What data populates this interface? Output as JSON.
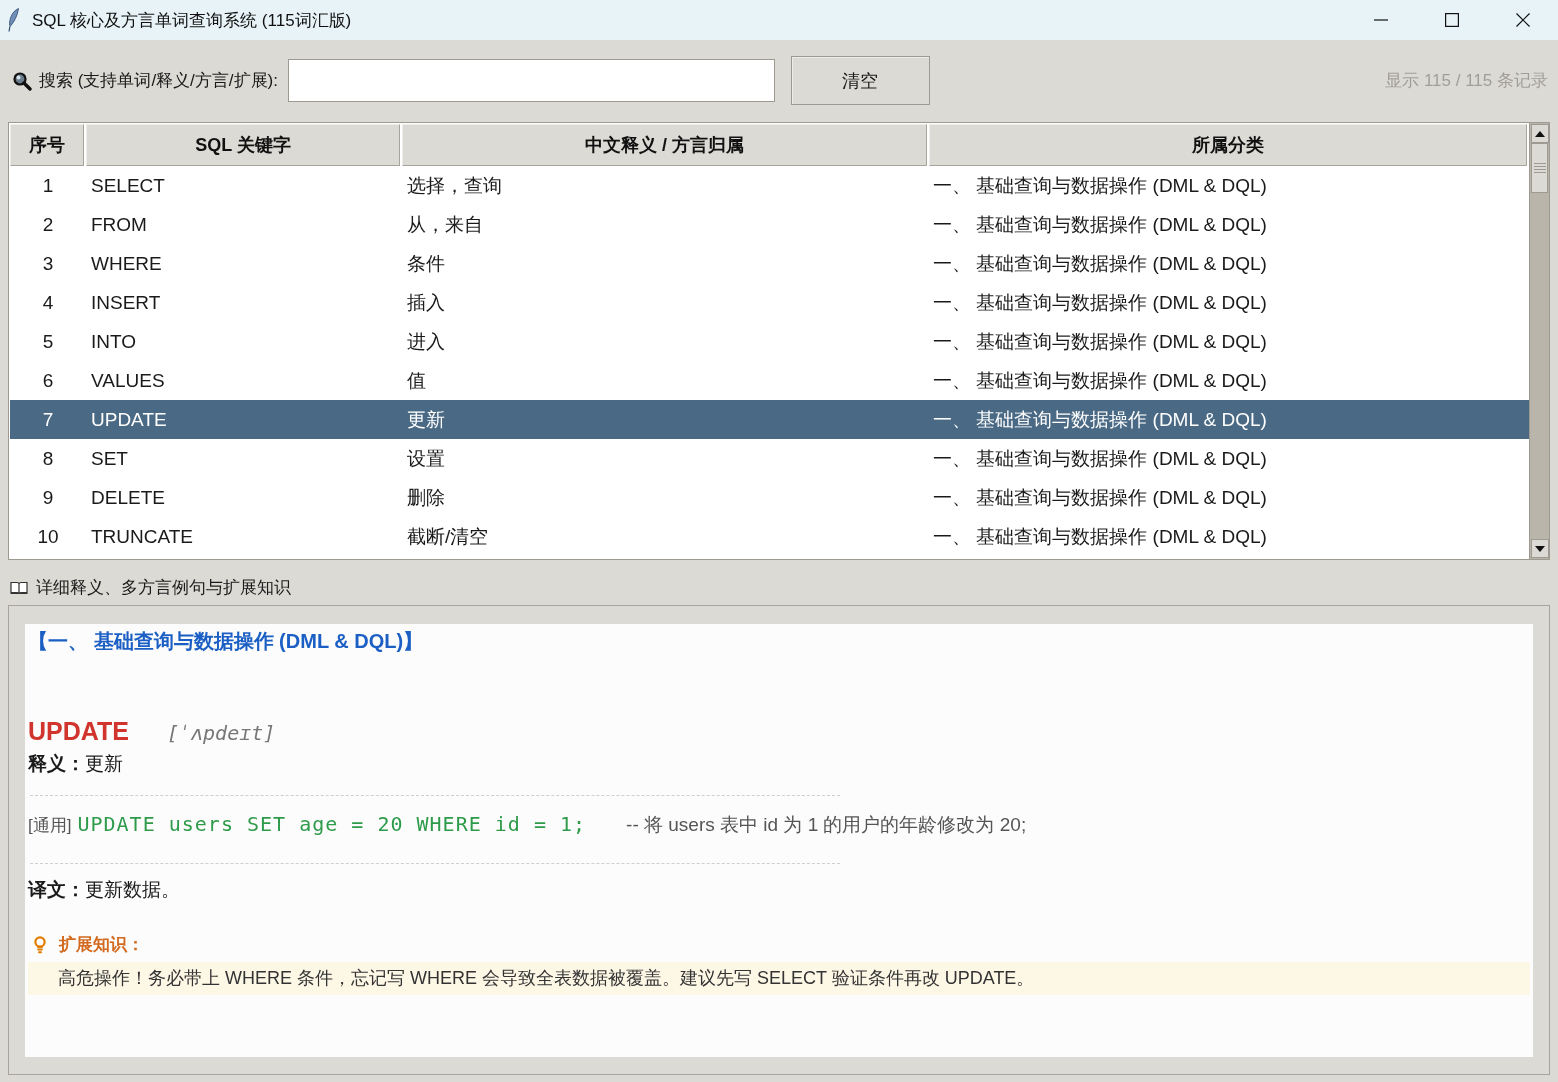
{
  "window": {
    "title": "SQL 核心及方言单词查询系统 (115词汇版)"
  },
  "search": {
    "label": "搜索 (支持单词/释义/方言/扩展):"
  },
  "clear_button": "清空",
  "record_count": "显示 115 / 115 条记录",
  "table": {
    "columns": [
      "序号",
      "SQL 关键字",
      "中文释义 / 方言归属",
      "所属分类"
    ],
    "rows": [
      {
        "cells": [
          "1",
          "SELECT",
          "选择，查询",
          "一、 基础查询与数据操作 (DML & DQL)"
        ],
        "selected": false
      },
      {
        "cells": [
          "2",
          "FROM",
          "从，来自",
          "一、 基础查询与数据操作 (DML & DQL)"
        ],
        "selected": false
      },
      {
        "cells": [
          "3",
          "WHERE",
          "条件",
          "一、 基础查询与数据操作 (DML & DQL)"
        ],
        "selected": false
      },
      {
        "cells": [
          "4",
          "INSERT",
          "插入",
          "一、 基础查询与数据操作 (DML & DQL)"
        ],
        "selected": false
      },
      {
        "cells": [
          "5",
          "INTO",
          "进入",
          "一、 基础查询与数据操作 (DML & DQL)"
        ],
        "selected": false
      },
      {
        "cells": [
          "6",
          "VALUES",
          "值",
          "一、 基础查询与数据操作 (DML & DQL)"
        ],
        "selected": false
      },
      {
        "cells": [
          "7",
          "UPDATE",
          "更新",
          "一、 基础查询与数据操作 (DML & DQL)"
        ],
        "selected": true
      },
      {
        "cells": [
          "8",
          "SET",
          "设置",
          "一、 基础查询与数据操作 (DML & DQL)"
        ],
        "selected": false
      },
      {
        "cells": [
          "9",
          "DELETE",
          "删除",
          "一、 基础查询与数据操作 (DML & DQL)"
        ],
        "selected": false
      },
      {
        "cells": [
          "10",
          "TRUNCATE",
          "截断/清空",
          "一、 基础查询与数据操作 (DML & DQL)"
        ],
        "selected": false
      }
    ]
  },
  "detail": {
    "title": "详细释义、多方言例句与扩展知识",
    "category_heading": "【一、 基础查询与数据操作 (DML & DQL)】",
    "keyword": "UPDATE",
    "phonetic": "[ˈʌpdeɪt]",
    "meaning": "**释义：**更新",
    "examples": [
      {
        "dialect": "[通用]",
        "code": "UPDATE users SET age = 20 WHERE id = 1;",
        "comment": "-- 将 users 表中 id 为 1 的用户的年龄修改为 20;"
      }
    ],
    "translation": "**译文：**更新数据。",
    "extension": {
      "label": "扩展知识：",
      "text": "高危操作！务必带上 WHERE 条件，忘记写 WHERE 会导致全表数据被覆盖。建议先写 SELECT 验证条件再改 UPDATE。"
    }
  }
}
